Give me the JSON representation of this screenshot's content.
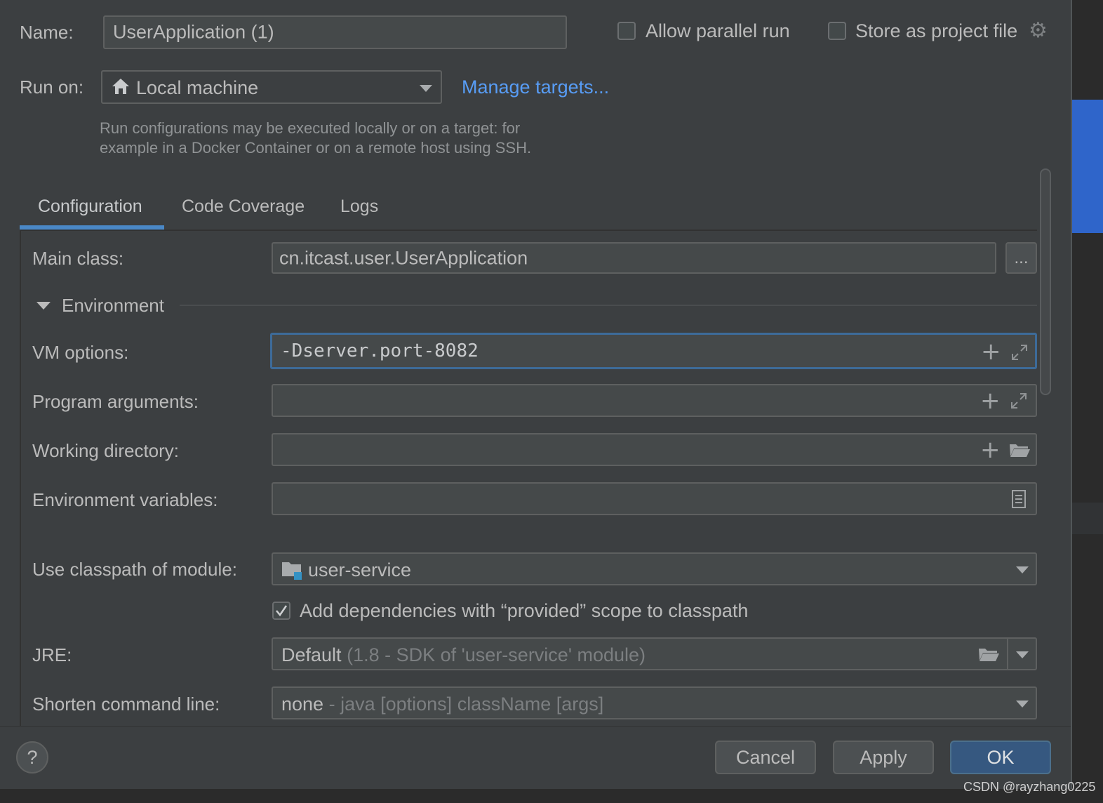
{
  "header": {
    "name_label": "Name:",
    "name_value": "UserApplication (1)",
    "allow_parallel_label": "Allow parallel run",
    "store_project_label": "Store as project file",
    "run_on_label": "Run on:",
    "run_on_value": "Local machine",
    "manage_targets_label": "Manage targets...",
    "hint_line1": "Run configurations may be executed locally or on a target: for",
    "hint_line2": "example in a Docker Container or on a remote host using SSH."
  },
  "tabs": [
    {
      "label": "Configuration",
      "active": true
    },
    {
      "label": "Code Coverage",
      "active": false
    },
    {
      "label": "Logs",
      "active": false
    }
  ],
  "form": {
    "main_class_label": "Main class:",
    "main_class_value": "cn.itcast.user.UserApplication",
    "browse_label": "...",
    "environment_label": "Environment",
    "vm_options_label": "VM options:",
    "vm_options_value": "-Dserver.port-8082",
    "program_args_label": "Program arguments:",
    "program_args_value": "",
    "working_dir_label": "Working directory:",
    "working_dir_value": "",
    "env_vars_label": "Environment variables:",
    "env_vars_value": "",
    "classpath_label": "Use classpath of module:",
    "classpath_value": "user-service",
    "add_deps_label": "Add dependencies with “provided” scope to classpath",
    "add_deps_checked": true,
    "jre_label": "JRE:",
    "jre_value": "Default",
    "jre_hint": "(1.8 - SDK of 'user-service' module)",
    "shorten_label": "Shorten command line:",
    "shorten_value": "none",
    "shorten_hint": "- java [options] className [args]"
  },
  "footer": {
    "help_label": "?",
    "cancel_label": "Cancel",
    "apply_label": "Apply",
    "ok_label": "OK"
  },
  "watermark": "CSDN @rayzhang0225",
  "colors": {
    "background": "#3c3f41",
    "field": "#45494a",
    "accent": "#4a88c7",
    "link": "#589df6",
    "primary_button": "#365880"
  }
}
